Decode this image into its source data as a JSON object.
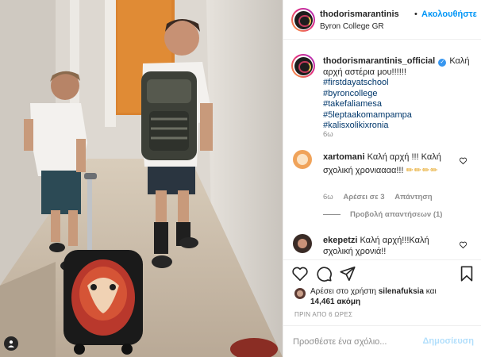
{
  "post": {
    "author": "thodorismarantinis_official",
    "header_user": "thodorismarantinis",
    "separator": "•",
    "follow_label": "Ακολουθήστε",
    "location": "Byron College GR",
    "caption_text": "Καλή αρχή αστέρια μου!!!!!!",
    "hashtags": [
      "#firstdayatschool",
      "#byroncollege",
      "#takefaliamesa",
      "#5leptaakomampampa",
      "#kalisxolikixronia"
    ],
    "caption_time": "6ω"
  },
  "comments": [
    {
      "user": "xartomani",
      "text": "Καλή αρχή !!! Καλή σχολική χρονιαααα!!!",
      "emoji": "✏✏✏✏",
      "time": "6ω",
      "likes": "Αρέσει σε 3",
      "reply": "Απάντηση",
      "view_replies": "Προβολή απαντήσεων (1)"
    },
    {
      "user": "ekepetzi",
      "text": "Καλή αρχή!!!Καλή σχολική χρονιά!!"
    }
  ],
  "actions": {
    "liked_by_prefix": "Αρέσει στο χρήστη",
    "liked_by_user": "silenafuksia",
    "and_word": "και",
    "others_count": "14,461",
    "others_suffix": "ακόμη",
    "timestamp": "ΠΡΙΝ ΑΠΟ 6 ΩΡΕΣ"
  },
  "add_comment": {
    "placeholder": "Προσθέστε ένα σχόλιο...",
    "post_label": "Δημοσίευση"
  },
  "colors": {
    "link_blue": "#0095f6",
    "hashtag_blue": "#00376b",
    "muted_gray": "#8e8e8e",
    "text": "#262626",
    "post_disabled": "#b2dffc"
  },
  "icons": [
    "tag-user-icon",
    "verified-badge-icon",
    "heart-icon",
    "comment-icon",
    "share-icon",
    "bookmark-icon"
  ]
}
